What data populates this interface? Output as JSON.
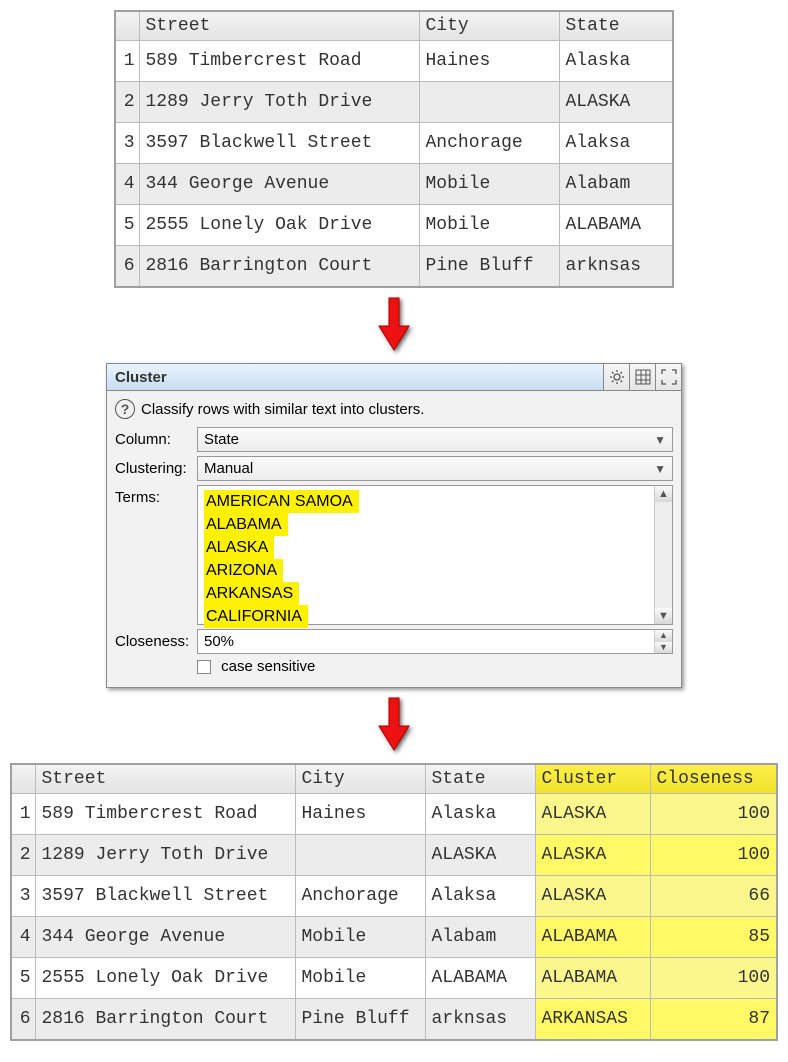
{
  "top_table": {
    "headers": [
      "Street",
      "City",
      "State"
    ],
    "rows": [
      {
        "n": "1",
        "street": "589 Timbercrest Road",
        "city": "Haines",
        "state": "Alaska"
      },
      {
        "n": "2",
        "street": "1289 Jerry Toth Drive",
        "city": "",
        "state": "ALASKA"
      },
      {
        "n": "3",
        "street": "3597 Blackwell Street",
        "city": "Anchorage",
        "state": "Alaksa"
      },
      {
        "n": "4",
        "street": "344 George Avenue",
        "city": "Mobile",
        "state": "Alabam"
      },
      {
        "n": "5",
        "street": "2555 Lonely Oak Drive",
        "city": "Mobile",
        "state": "ALABAMA"
      },
      {
        "n": "6",
        "street": "2816 Barrington Court",
        "city": "Pine Bluff",
        "state": "arknsas"
      }
    ]
  },
  "panel": {
    "title": "Cluster",
    "help": "Classify rows with similar text into clusters.",
    "labels": {
      "column": "Column:",
      "clustering": "Clustering:",
      "terms": "Terms:",
      "closeness": "Closeness:",
      "case_sensitive": "case sensitive"
    },
    "column_value": "State",
    "clustering_value": "Manual",
    "terms": [
      "AMERICAN SAMOA",
      "ALABAMA",
      "ALASKA",
      "ARIZONA",
      "ARKANSAS",
      "CALIFORNIA"
    ],
    "closeness_value": "50%"
  },
  "result_table": {
    "headers": [
      "Street",
      "City",
      "State",
      "Cluster",
      "Closeness"
    ],
    "rows": [
      {
        "n": "1",
        "street": "589 Timbercrest Road",
        "city": "Haines",
        "state": "Alaska",
        "cluster": "ALASKA",
        "close": "100"
      },
      {
        "n": "2",
        "street": "1289 Jerry Toth Drive",
        "city": "",
        "state": "ALASKA",
        "cluster": "ALASKA",
        "close": "100"
      },
      {
        "n": "3",
        "street": "3597 Blackwell Street",
        "city": "Anchorage",
        "state": "Alaksa",
        "cluster": "ALASKA",
        "close": "66"
      },
      {
        "n": "4",
        "street": "344 George Avenue",
        "city": "Mobile",
        "state": "Alabam",
        "cluster": "ALABAMA",
        "close": "85"
      },
      {
        "n": "5",
        "street": "2555 Lonely Oak Drive",
        "city": "Mobile",
        "state": "ALABAMA",
        "cluster": "ALABAMA",
        "close": "100"
      },
      {
        "n": "6",
        "street": "2816 Barrington Court",
        "city": "Pine Bluff",
        "state": "arknsas",
        "cluster": "ARKANSAS",
        "close": "87"
      }
    ]
  }
}
